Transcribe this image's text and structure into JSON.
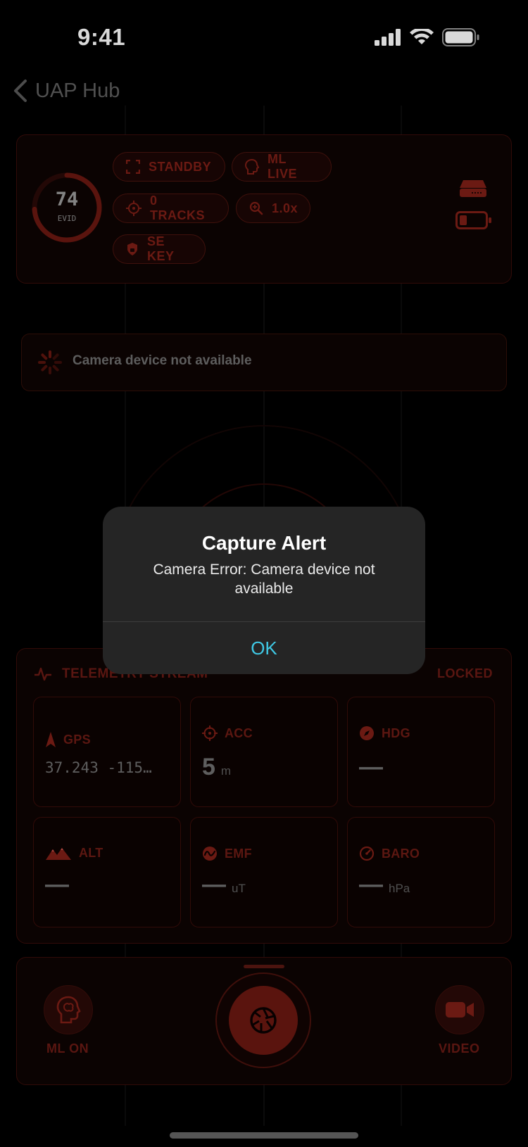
{
  "status_bar": {
    "time": "9:41"
  },
  "nav": {
    "back_label": "UAP Hub"
  },
  "header": {
    "evid_value": "74",
    "evid_label": "EVID",
    "chips": {
      "standby": "STANDBY",
      "ml_live": "ML LIVE",
      "tracks": "0 TRACKS",
      "zoom": "1.0x",
      "se_key": "SE KEY"
    }
  },
  "banner": {
    "text": "Camera device not available"
  },
  "telemetry": {
    "title": "TELEMETRY STREAM",
    "status": "LOCKED",
    "tiles": {
      "gps": {
        "label": "GPS",
        "value": "37.243 -115…"
      },
      "acc": {
        "label": "ACC",
        "value": "5",
        "unit": "m"
      },
      "hdg": {
        "label": "HDG",
        "value": "—"
      },
      "alt": {
        "label": "ALT",
        "value": "—"
      },
      "emf": {
        "label": "EMF",
        "value": "—",
        "unit": "uT"
      },
      "baro": {
        "label": "BARO",
        "value": "—",
        "unit": "hPa"
      }
    }
  },
  "controls": {
    "ml_label": "ML ON",
    "video_label": "VIDEO"
  },
  "alert": {
    "title": "Capture Alert",
    "message": "Camera Error: Camera device not available",
    "ok_label": "OK"
  },
  "colors": {
    "accent_red": "#7e1f17",
    "alert_button": "#3fc8e4",
    "alert_bg": "#252525"
  }
}
